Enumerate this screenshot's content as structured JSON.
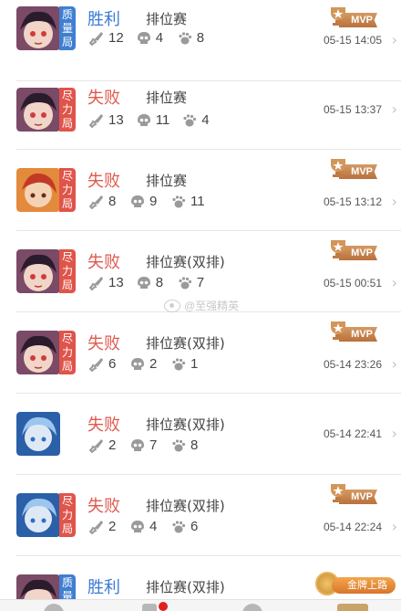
{
  "matches": [
    {
      "result": "胜利",
      "result_type": "win",
      "badge": [
        "质",
        "量",
        "局"
      ],
      "badge_color": "blue",
      "mode": "排位赛",
      "kills": "12",
      "deaths": "4",
      "assists": "8",
      "time": "05-15 14:05",
      "mvp": true,
      "hero": "hero-a"
    },
    {
      "result": "失败",
      "result_type": "loss",
      "badge": [
        "尽",
        "力",
        "局"
      ],
      "badge_color": "red",
      "mode": "排位赛",
      "kills": "13",
      "deaths": "11",
      "assists": "4",
      "time": "05-15 13:37",
      "mvp": false,
      "hero": "hero-a"
    },
    {
      "result": "失败",
      "result_type": "loss",
      "badge": [
        "尽",
        "力",
        "局"
      ],
      "badge_color": "red",
      "mode": "排位赛",
      "kills": "8",
      "deaths": "9",
      "assists": "11",
      "time": "05-15 13:12",
      "mvp": true,
      "hero": "hero-b"
    },
    {
      "result": "失败",
      "result_type": "loss",
      "badge": [
        "尽",
        "力",
        "局"
      ],
      "badge_color": "red",
      "mode": "排位赛(双排)",
      "kills": "13",
      "deaths": "8",
      "assists": "7",
      "time": "05-15 00:51",
      "mvp": true,
      "hero": "hero-a"
    },
    {
      "result": "失败",
      "result_type": "loss",
      "badge": [
        "尽",
        "力",
        "局"
      ],
      "badge_color": "red",
      "mode": "排位赛(双排)",
      "kills": "6",
      "deaths": "2",
      "assists": "1",
      "time": "05-14 23:26",
      "mvp": true,
      "hero": "hero-a"
    },
    {
      "result": "失败",
      "result_type": "loss",
      "badge": [],
      "badge_color": "",
      "mode": "排位赛(双排)",
      "kills": "2",
      "deaths": "7",
      "assists": "8",
      "time": "05-14 22:41",
      "mvp": false,
      "hero": "hero-c"
    },
    {
      "result": "失败",
      "result_type": "loss",
      "badge": [
        "尽",
        "力",
        "局"
      ],
      "badge_color": "red",
      "mode": "排位赛(双排)",
      "kills": "2",
      "deaths": "4",
      "assists": "6",
      "time": "05-14 22:24",
      "mvp": true,
      "hero": "hero-c"
    },
    {
      "result": "胜利",
      "result_type": "win",
      "badge": [
        "质",
        "量",
        "局"
      ],
      "badge_color": "blue",
      "mode": "排位赛(双排)",
      "kills": "",
      "deaths": "",
      "assists": "",
      "time": "",
      "mvp": false,
      "hero": "hero-a"
    }
  ],
  "mvp_label": "MVP",
  "gold_label": "金牌上路",
  "watermark": "@至强精英",
  "chevron": "›",
  "colors": {
    "win": "#3a7bd5",
    "loss": "#e05a4e",
    "badge_blue": "#3f7fd0",
    "badge_red": "#e0544a",
    "mvp": "#c07a42"
  }
}
